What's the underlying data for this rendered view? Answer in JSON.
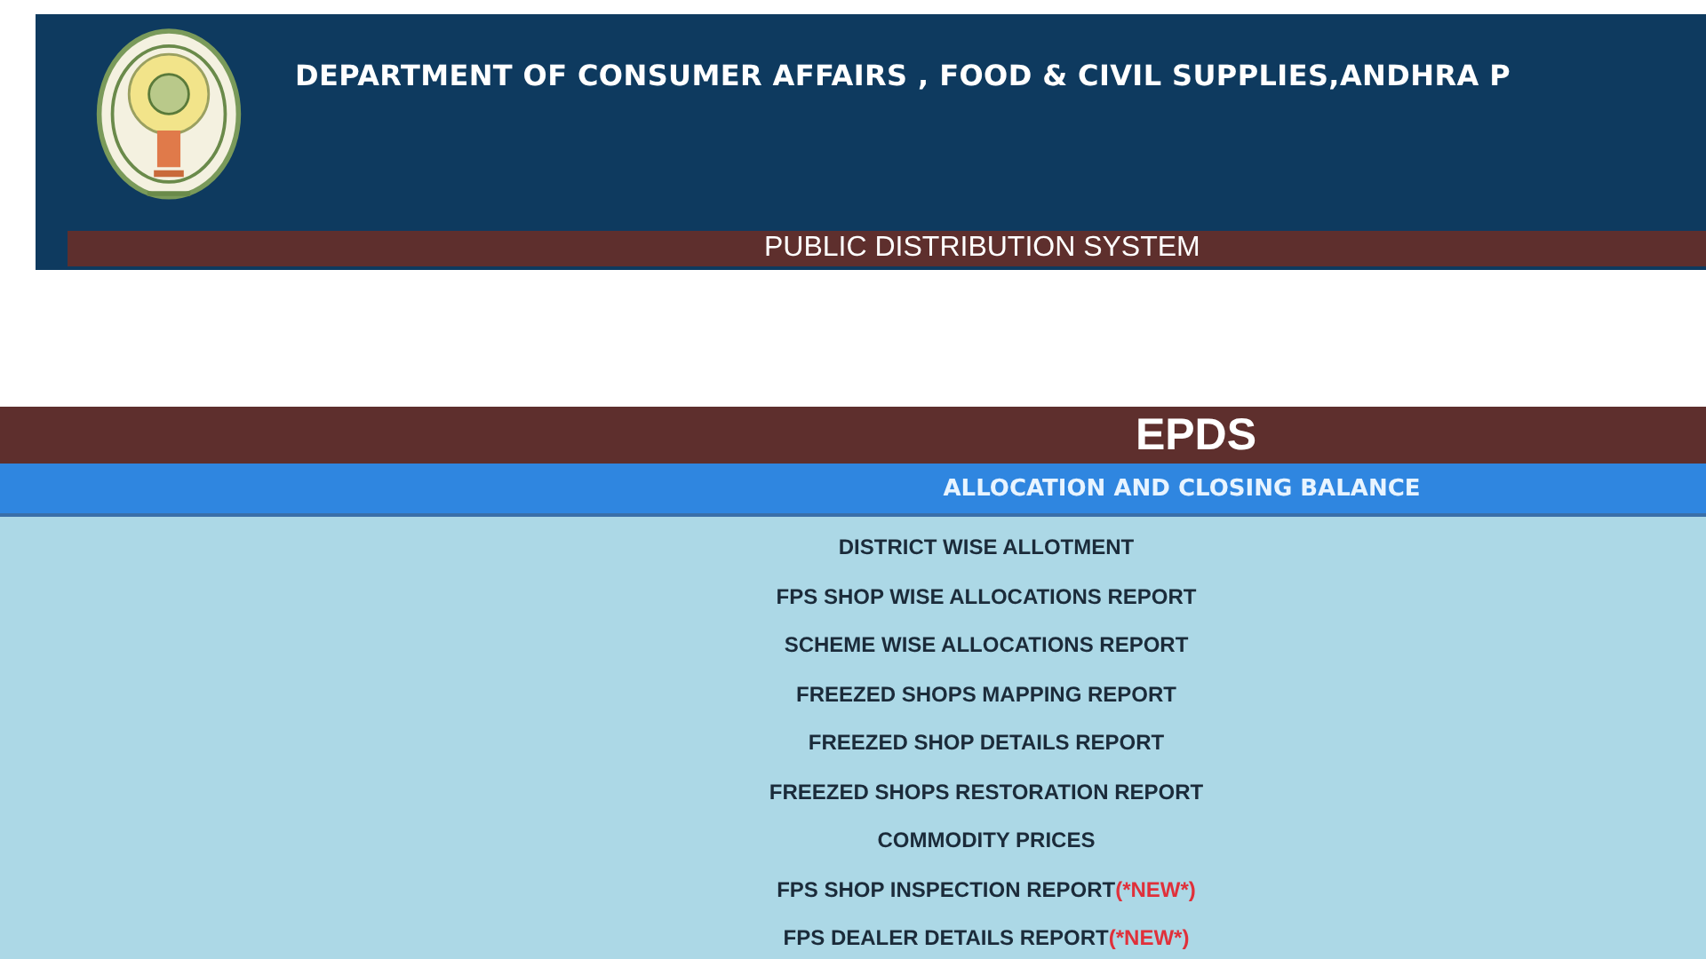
{
  "header": {
    "title": "DEPARTMENT OF CONSUMER AFFAIRS , FOOD & CIVIL SUPPLIES,ANDHRA P",
    "subtitle": "PUBLIC DISTRIBUTION SYSTEM"
  },
  "section": {
    "title": "EPDS",
    "heading": "ALLOCATION AND CLOSING BALANCE"
  },
  "menu": [
    {
      "label": "DISTRICT WISE ALLOTMENT"
    },
    {
      "label": "FPS SHOP WISE ALLOCATIONS REPORT"
    },
    {
      "label": "SCHEME WISE ALLOCATIONS REPORT"
    },
    {
      "label": "FREEZED SHOPS MAPPING REPORT"
    },
    {
      "label": "FREEZED SHOP DETAILS REPORT"
    },
    {
      "label": "FREEZED SHOPS RESTORATION REPORT"
    },
    {
      "label": "COMMODITY PRICES"
    },
    {
      "label": "FPS SHOP INSPECTION REPORT",
      "badge": "(*NEW*)"
    },
    {
      "label": "FPS DEALER DETAILS REPORT",
      "badge": "(*NEW*)"
    }
  ]
}
